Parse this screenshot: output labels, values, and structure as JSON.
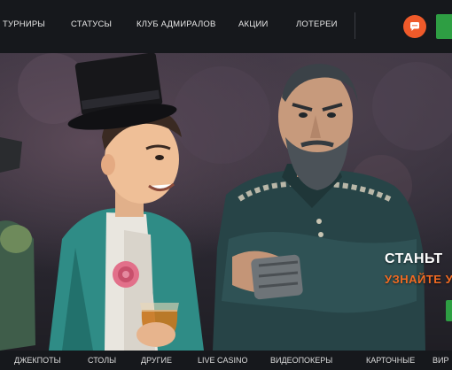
{
  "top_nav": {
    "items": [
      {
        "label": "ТУРНИРЫ"
      },
      {
        "label": "СТАТУСЫ"
      },
      {
        "label": "КЛУБ АДМИРАЛОВ"
      },
      {
        "label": "АКЦИИ"
      },
      {
        "label": "ЛОТЕРЕИ"
      }
    ],
    "chat_icon": "chat-bubble-icon",
    "accent_color": "#ef5a2a",
    "cta_color": "#2e9e43"
  },
  "hero": {
    "promo_title": "СТАНЬТ",
    "promo_subtitle": "УЗНАЙТЕ У",
    "title_color": "#ffffff",
    "subtitle_color": "#f26a21"
  },
  "categories": {
    "items": [
      {
        "label": "ДЖЕКПОТЫ"
      },
      {
        "label": "СТОЛЫ"
      },
      {
        "label": "ДРУГИЕ"
      },
      {
        "label": "LIVE CASINO"
      },
      {
        "label": "ВИДЕОПОКЕРЫ"
      },
      {
        "label": "КАРТОЧНЫЕ"
      },
      {
        "label": "ВИР"
      }
    ]
  }
}
